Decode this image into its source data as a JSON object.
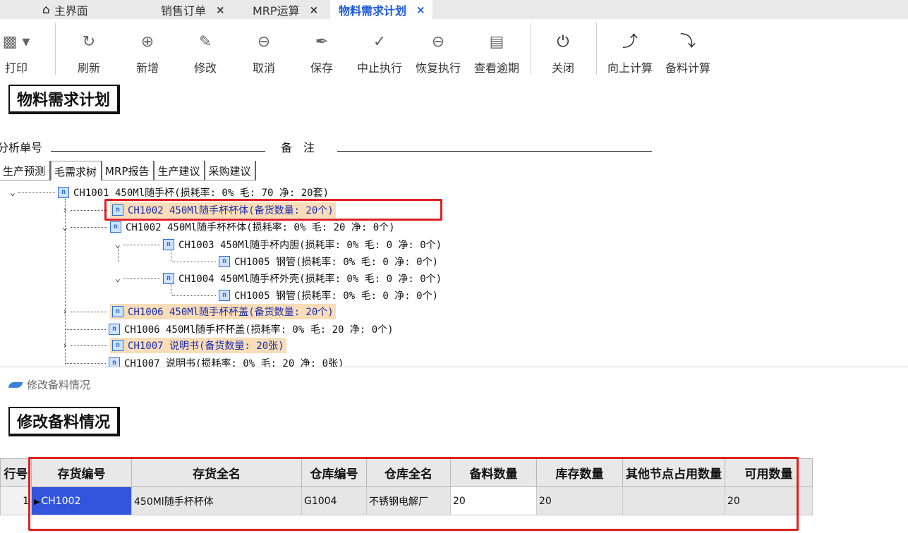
{
  "tabs": [
    {
      "label": "主界面",
      "icon": "home-icon",
      "closable": false
    },
    {
      "label": "销售订单",
      "closable": true
    },
    {
      "label": "MRP运算",
      "closable": true
    },
    {
      "label": "物料需求计划",
      "closable": true,
      "active": true
    }
  ],
  "close_glyph": "×",
  "toolbar": [
    {
      "label": "打印",
      "icon": "printer-icon"
    },
    {
      "label": "刷新",
      "icon": "refresh-icon"
    },
    {
      "label": "新增",
      "icon": "add-icon"
    },
    {
      "label": "修改",
      "icon": "edit-icon"
    },
    {
      "label": "取消",
      "icon": "cancel-icon"
    },
    {
      "label": "保存",
      "icon": "save-icon"
    },
    {
      "label": "中止执行",
      "icon": "stop-icon"
    },
    {
      "label": "恢复执行",
      "icon": "resume-icon"
    },
    {
      "label": "查看逾期",
      "icon": "calendar-icon"
    },
    {
      "label": "关闭",
      "icon": "power-icon"
    },
    {
      "label": "向上计算",
      "icon": "arrow-up-icon"
    },
    {
      "label": "备料计算",
      "icon": "arrow-down-icon"
    }
  ],
  "page_title": "物料需求计划",
  "fields": {
    "analysis_no_label": "分析单号",
    "remark_label": "备　注",
    "analysis_no": "",
    "remark": ""
  },
  "subtabs": [
    "生产预测",
    "毛需求树",
    "MRP报告",
    "生产建议",
    "采购建议"
  ],
  "tree": [
    "CH1001 450Ml随手杯(损耗率: 0% 毛: 70 净: 20套)",
    "CH1002 450Ml随手杯杯体(备货数量: 20个)",
    "CH1002 450Ml随手杯杯体(损耗率: 0% 毛: 20 净: 0个)",
    "CH1003 450Ml随手杯内胆(损耗率: 0% 毛: 0 净: 0个)",
    "CH1005 钢管(损耗率: 0% 毛: 0 净: 0个)",
    "CH1004 450Ml随手杯外壳(损耗率: 0% 毛: 0 净: 0个)",
    "CH1005 钢管(损耗率: 0% 毛: 0 净: 0个)",
    "CH1006 450Ml随手杯杯盖(备货数量: 20个)",
    "CH1006 450Ml随手杯杯盖(损耗率: 0% 毛: 20 净: 0个)",
    "CH1007 说明书(备货数量: 20张)",
    "CH1007 说明书(损耗率: 0% 毛: 20 净: 0张)"
  ],
  "dialog": {
    "window_title": "修改备料情况",
    "heading": "修改备料情况",
    "columns": [
      "行号",
      "存货编号",
      "存货全名",
      "仓库编号",
      "仓库全名",
      "备料数量",
      "库存数量",
      "其他节点占用数量",
      "可用数量"
    ],
    "rows": [
      {
        "row_no": "1",
        "item_code": "CH1002",
        "item_name": "450Ml随手杯杯体",
        "wh_code": "G1004",
        "wh_name": "不锈钢电解厂",
        "prep_qty": "20",
        "stock_qty": "20",
        "other_qty": "",
        "avail_qty": "20"
      }
    ]
  }
}
